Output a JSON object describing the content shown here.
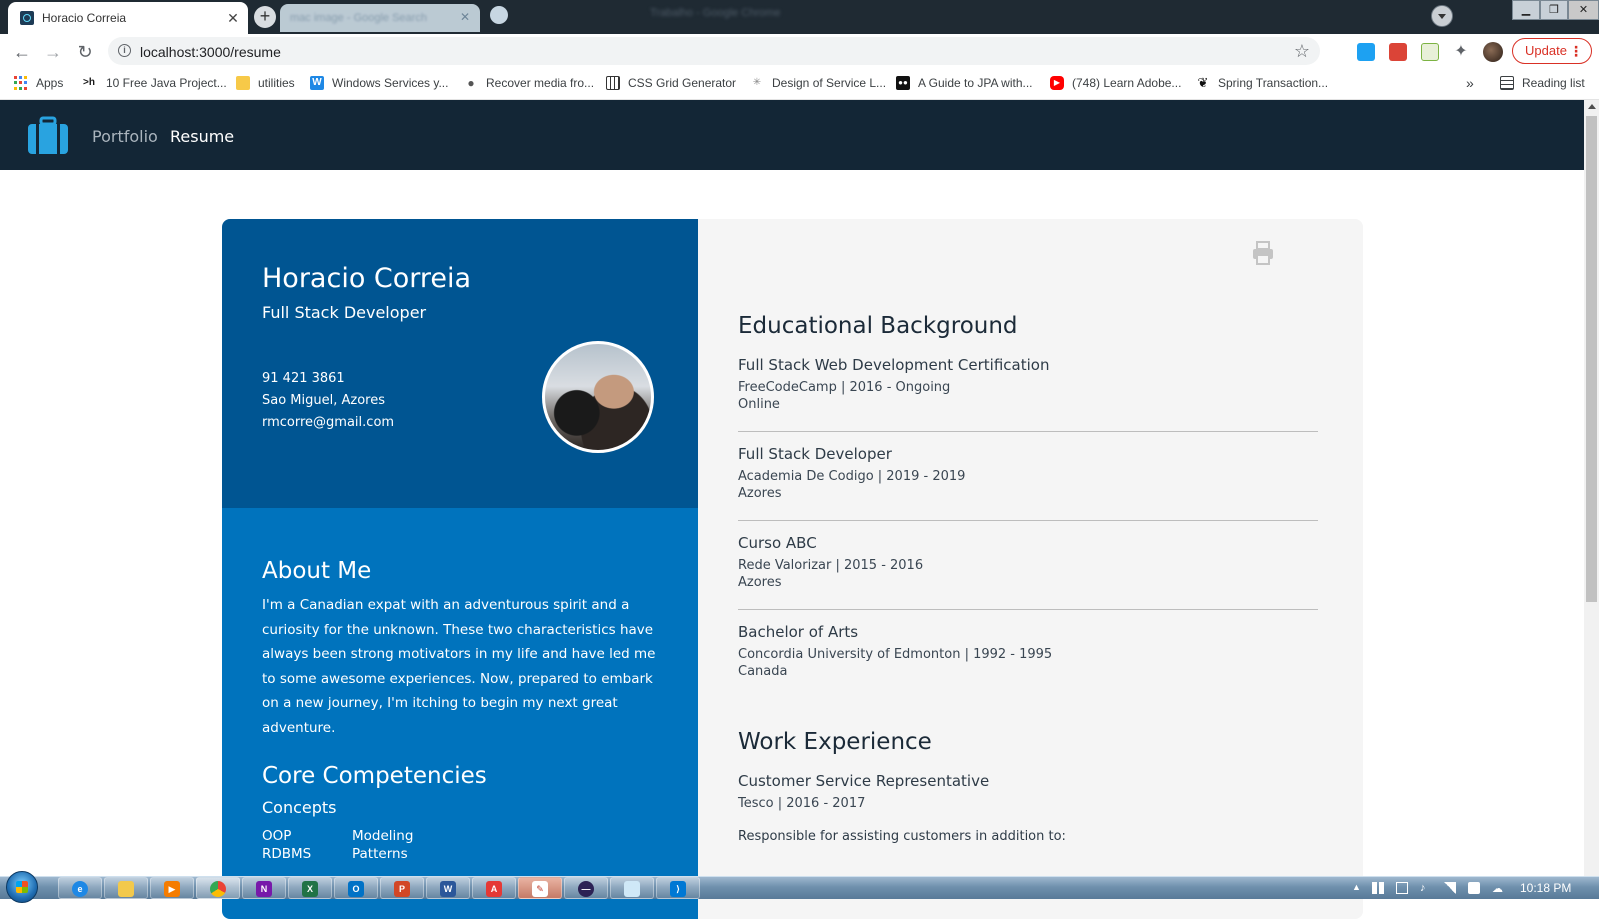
{
  "browser": {
    "tab_title": "Horacio Correia",
    "new_tab_label": "+",
    "blurred_tab_title": "mac image - Google Search",
    "window_title": "Trabalho - Google Chrome",
    "url": "localhost:3000/resume",
    "update_label": "Update",
    "bookmarks": [
      {
        "label": "Apps"
      },
      {
        "label": "10 Free Java Project..."
      },
      {
        "label": "utilities"
      },
      {
        "label": "Windows Services y..."
      },
      {
        "label": "Recover media fro..."
      },
      {
        "label": "CSS Grid Generator"
      },
      {
        "label": "Design of Service L..."
      },
      {
        "label": "A Guide to JPA with..."
      },
      {
        "label": "(748) Learn Adobe..."
      },
      {
        "label": "Spring Transaction..."
      }
    ],
    "bookmarks_more": "»",
    "reading_list_label": "Reading list"
  },
  "site": {
    "nav": [
      {
        "label": "Portfolio",
        "active": false
      },
      {
        "label": "Resume",
        "active": true
      }
    ]
  },
  "resume": {
    "name": "Horacio Correia",
    "role": "Full Stack Developer",
    "phone": "91 421 3861",
    "location": "Sao Miguel, Azores",
    "email": "rmcorre@gmail.com",
    "about_title": "About Me",
    "about_text": "I'm a Canadian expat with an adventurous spirit and a curiosity for the unknown. These two characteristics have always been strong motivators in my life and have led me to some awesome experiences. Now, prepared to embark on a new journey, I'm itching to begin my next great adventure.",
    "competencies_title": "Core Competencies",
    "concepts_label": "Concepts",
    "concepts": [
      "OOP",
      "Modeling",
      "RDBMS",
      "Patterns"
    ],
    "education_title": "Educational Background",
    "education": [
      {
        "title": "Full Stack Web Development Certification",
        "sub": "FreeCodeCamp | 2016 - Ongoing",
        "loc": "Online"
      },
      {
        "title": "Full Stack Developer",
        "sub": "Academia De Codigo | 2019 - 2019",
        "loc": "Azores"
      },
      {
        "title": "Curso ABC",
        "sub": "Rede Valorizar | 2015 - 2016",
        "loc": "Azores"
      },
      {
        "title": "Bachelor of Arts",
        "sub": "Concordia University of Edmonton | 1992 - 1995",
        "loc": "Canada"
      }
    ],
    "work_title": "Work Experience",
    "work": [
      {
        "title": "Customer Service Representative",
        "sub": "Tesco | 2016 - 2017",
        "desc": "Responsible for assisting customers in addition to:"
      }
    ]
  },
  "taskbar": {
    "time": "10:18 PM"
  },
  "colors": {
    "header_bg": "#132636",
    "left_top_bg": "#005592",
    "left_bottom_bg": "#0073bd",
    "right_bg": "#f5f5f5",
    "accent_logo": "#29a3e0"
  }
}
